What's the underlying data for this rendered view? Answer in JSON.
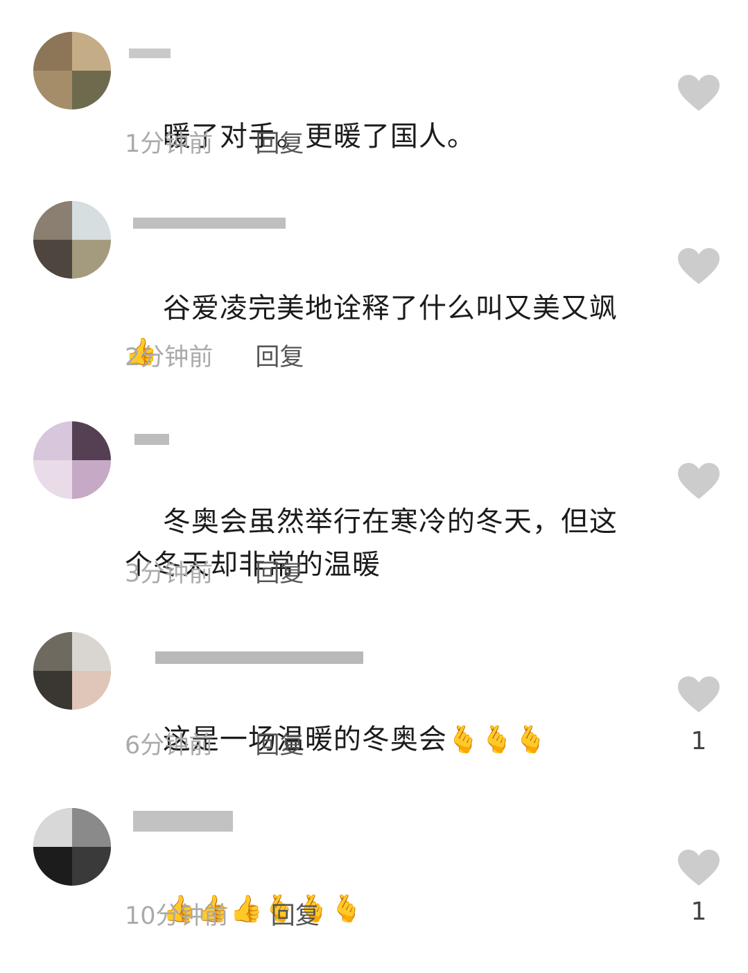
{
  "colors": {
    "heart": "#cccccc",
    "meta_text": "#aaaaaa",
    "reply_text": "#555555",
    "body_text": "#1b1b1b"
  },
  "comments": [
    {
      "text": "暖了对手。更暖了国人。",
      "time": "1分钟前",
      "reply": "回复",
      "likes": "",
      "emoji": ""
    },
    {
      "text": "谷爱凌完美地诠释了什么叫又美又飒",
      "time": "2分钟前",
      "reply": "回复",
      "likes": "",
      "emoji": "👍"
    },
    {
      "text": "冬奥会虽然举行在寒冷的冬天，但这个冬天却非常的温暖",
      "time": "3分钟前",
      "reply": "回复",
      "likes": "",
      "emoji": ""
    },
    {
      "text": "这是一场温暖的冬奥会",
      "time": "6分钟前",
      "reply": "回复",
      "likes": "1",
      "emoji": "🫰🫰🫰"
    },
    {
      "text": "",
      "time": "10分钟前",
      "reply": "回复",
      "likes": "1",
      "emoji": "👍👍👍🫰🫰🫰"
    }
  ],
  "icons": {
    "like": "heart-icon",
    "avatar": "blurred-avatar"
  }
}
